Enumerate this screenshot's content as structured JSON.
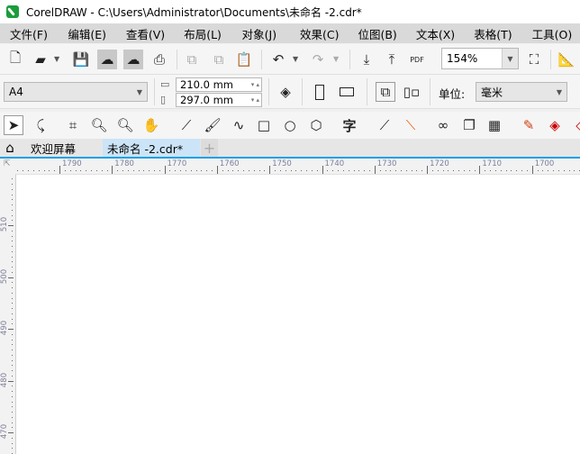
{
  "window": {
    "title": "CorelDRAW - C:\\Users\\Administrator\\Documents\\未命名 -2.cdr*"
  },
  "menu": [
    "文件(F)",
    "编辑(E)",
    "查看(V)",
    "布局(L)",
    "对象(J)",
    "效果(C)",
    "位图(B)",
    "文本(X)",
    "表格(T)",
    "工具(O)"
  ],
  "toolbar": {
    "zoom_level": "154%",
    "pdf_label": "PDF"
  },
  "property_bar": {
    "page_size": "A4",
    "width": "210.0 mm",
    "height": "297.0 mm",
    "units_label": "单位:",
    "units_value": "毫米"
  },
  "tabs": [
    {
      "label": "欢迎屏幕",
      "active": false
    },
    {
      "label": "未命名 -2.cdr*",
      "active": true
    }
  ],
  "rulers": {
    "horizontal": [
      "1790",
      "1780",
      "1770",
      "1760",
      "1750",
      "1740",
      "1730",
      "1720",
      "1710",
      "1700"
    ],
    "vertical": [
      "510",
      "500",
      "490",
      "480",
      "470"
    ]
  },
  "colors": {
    "accent": "#1aa0e8",
    "active_tab": "#cce4f7",
    "menu_bg": "#d9d9d9"
  }
}
